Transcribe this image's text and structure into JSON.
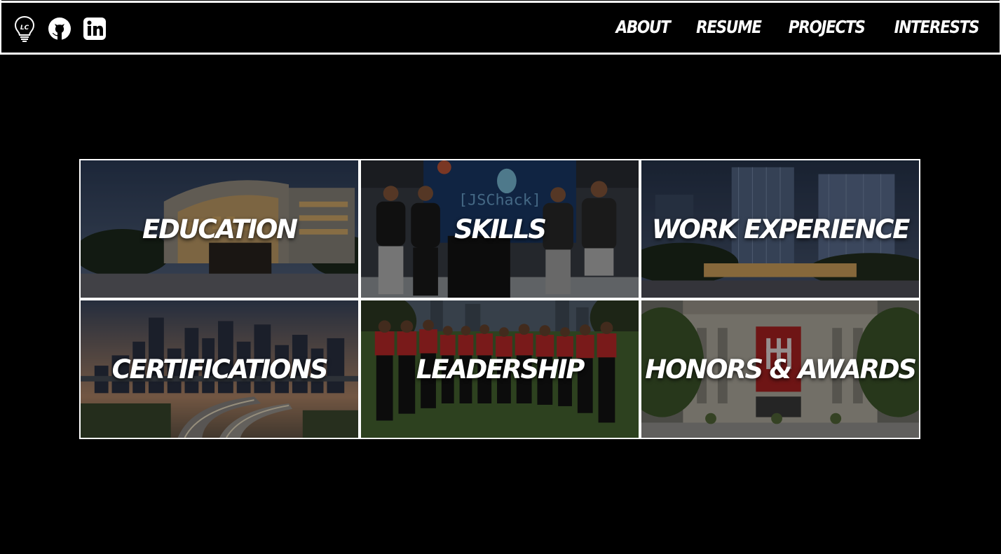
{
  "header": {
    "icons": [
      "lc-lightbulb-logo-icon",
      "github-icon",
      "linkedin-icon"
    ],
    "logo_initials": "LC",
    "nav": [
      {
        "label": "ABOUT"
      },
      {
        "label": "RESUME"
      },
      {
        "label": "PROJECTS"
      },
      {
        "label": "INTERESTS"
      }
    ]
  },
  "tiles": [
    {
      "label": "EDUCATION"
    },
    {
      "label": "SKILLS"
    },
    {
      "label": "WORK EXPERIENCE"
    },
    {
      "label": "CERTIFICATIONS"
    },
    {
      "label": "LEADERSHIP"
    },
    {
      "label": "HONORS & AWARDS"
    }
  ],
  "photo_text": {
    "skills_sign": "[JSChack]"
  },
  "colors": {
    "background": "#000000",
    "foreground": "#ffffff"
  }
}
